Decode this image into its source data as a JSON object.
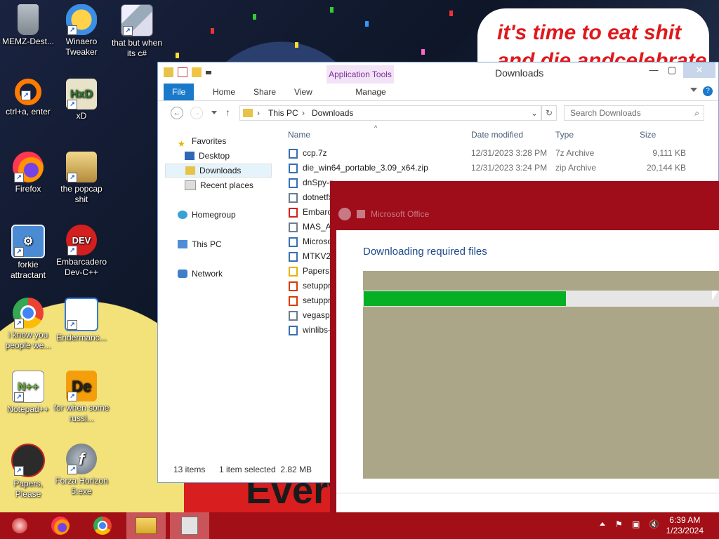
{
  "desktop": {
    "wallpaper_text": "it's time to eat shit",
    "wallpaper_text2": "and die andcelebrate",
    "banner_text": "Every",
    "icons": [
      {
        "label": "MEMZ-Dest...",
        "icon": "recycle-bin-icon",
        "color": "#8a8a8a"
      },
      {
        "label": "Winaero Tweaker",
        "icon": "winaero-icon",
        "color": "#f5a623"
      },
      {
        "label": "that but when its c#",
        "icon": "stacked-windows-icon",
        "color": "#9ab"
      },
      {
        "label": "ctrl+a, enter",
        "icon": "orange-ring-icon",
        "color": "#ff7a00"
      },
      {
        "label": "xD",
        "icon": "hxd-icon",
        "color": "#cfa24a"
      },
      {
        "label": "Firefox",
        "icon": "firefox-icon",
        "color": "#ff6a1a"
      },
      {
        "label": "the popcap shit",
        "icon": "popcap-icon",
        "color": "#6a4fb3"
      },
      {
        "label": "forkie attractant",
        "icon": "monitor-gear-icon",
        "color": "#4b8bd4"
      },
      {
        "label": "Embarcadero Dev-C++",
        "icon": "devcpp-icon",
        "color": "#d41f1f"
      },
      {
        "label": "i know you people we...",
        "icon": "chrome-icon",
        "color": "#e8453c"
      },
      {
        "label": "Endermanc...",
        "icon": "document-window-icon",
        "color": "#3a7bd5"
      },
      {
        "label": "Notepad++",
        "icon": "notepadpp-icon",
        "color": "#8bc34a"
      },
      {
        "label": "for when some russi...",
        "icon": "de-icon",
        "color": "#f59e0b"
      },
      {
        "label": "Papers, Please",
        "icon": "papers-please-icon",
        "color": "#2b2b2b"
      },
      {
        "label": "Forza Horizon 5:exe",
        "icon": "flash-icon",
        "color": "#6d7885"
      }
    ]
  },
  "explorer": {
    "title": "Downloads",
    "application_tools": "Application Tools",
    "tabs": {
      "file": "File",
      "home": "Home",
      "share": "Share",
      "view": "View",
      "manage": "Manage"
    },
    "address": {
      "root": "This PC",
      "current": "Downloads"
    },
    "search_placeholder": "Search Downloads",
    "nav": {
      "favorites": "Favorites",
      "desktop": "Desktop",
      "downloads": "Downloads",
      "recent": "Recent places",
      "homegroup": "Homegroup",
      "thispc": "This PC",
      "network": "Network"
    },
    "columns": {
      "name": "Name",
      "date": "Date modified",
      "type": "Type",
      "size": "Size"
    },
    "files": [
      {
        "name": "ccp.7z",
        "date": "12/31/2023 3:28 PM",
        "type": "7z Archive",
        "size": "9,111 KB",
        "icon": "archive-icon",
        "color": "#3a6fb0"
      },
      {
        "name": "die_win64_portable_3.09_x64.zip",
        "date": "12/31/2023 3:24 PM",
        "type": "zip Archive",
        "size": "20,144 KB",
        "icon": "archive-icon",
        "color": "#3a6fb0"
      },
      {
        "name": "dnSpy-n",
        "date": "",
        "type": "",
        "size": "",
        "icon": "archive-icon",
        "color": "#3a6fb0"
      },
      {
        "name": "dotnetfx",
        "date": "",
        "type": "",
        "size": "",
        "icon": "installer-icon",
        "color": "#6a7c8f"
      },
      {
        "name": "Embarc",
        "date": "",
        "type": "",
        "size": "",
        "icon": "devcpp-icon",
        "color": "#d41f1f"
      },
      {
        "name": "MAS_AI",
        "date": "",
        "type": "",
        "size": "",
        "icon": "script-icon",
        "color": "#6e7e90"
      },
      {
        "name": "Microso",
        "date": "",
        "type": "",
        "size": "",
        "icon": "archive-icon",
        "color": "#3a6fb0"
      },
      {
        "name": "MTKV2",
        "date": "",
        "type": "",
        "size": "",
        "icon": "archive-icon",
        "color": "#3a6fb0"
      },
      {
        "name": "PapersP",
        "date": "",
        "type": "",
        "size": "",
        "icon": "setup-icon",
        "color": "#e7b400"
      },
      {
        "name": "setuppr",
        "date": "",
        "type": "",
        "size": "",
        "icon": "office-icon",
        "color": "#d83b01"
      },
      {
        "name": "setuppr",
        "date": "",
        "type": "",
        "size": "",
        "icon": "office-icon",
        "color": "#d83b01"
      },
      {
        "name": "vegaspr",
        "date": "",
        "type": "",
        "size": "",
        "icon": "installer-icon",
        "color": "#6a7c8f"
      },
      {
        "name": "winlibs-",
        "date": "",
        "type": "",
        "size": "",
        "icon": "archive-icon",
        "color": "#3a6fb0"
      }
    ],
    "status": {
      "items": "13 items",
      "selected": "1 item selected  2.82 MB"
    }
  },
  "installer": {
    "title": "Microsoft Office",
    "heading": "Downloading required files",
    "progress": 0.57
  },
  "taskbar": {
    "time": "6:39 AM",
    "date": "1/23/2024",
    "apps": [
      "start-icon",
      "firefox-icon",
      "chrome-icon",
      "file-explorer-icon",
      "installer-icon"
    ]
  },
  "colors": {
    "taskbar": "#a30f16",
    "accent": "#1979ca",
    "progress": "#06b025",
    "installer_frame": "#9f0d1b"
  }
}
